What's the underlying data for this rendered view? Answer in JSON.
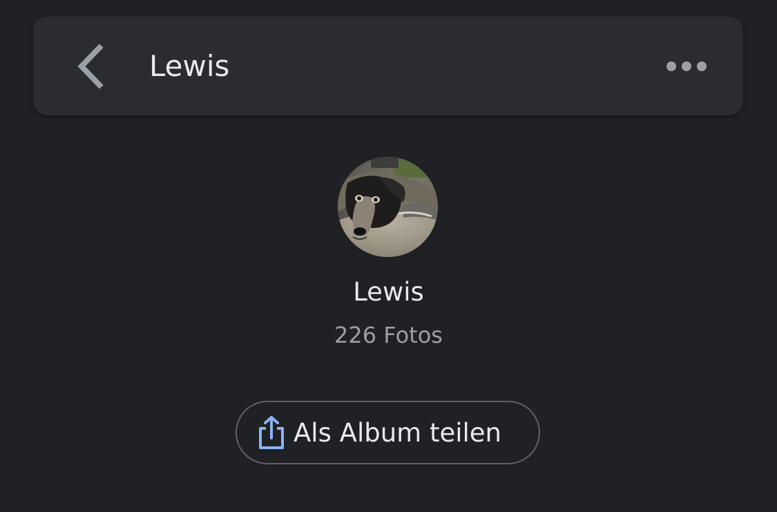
{
  "header": {
    "title": "Lewis",
    "back_icon": "chevron-left-icon",
    "more_icon": "more-horizontal-icon"
  },
  "profile": {
    "name": "Lewis",
    "photo_count": "226 Fotos",
    "avatar_subject": "dog-photo"
  },
  "share": {
    "label": "Als Album teilen",
    "icon": "share-icon",
    "icon_color": "#8ab4f8"
  },
  "colors": {
    "background": "#202124",
    "topbar": "#2b2c30",
    "text_primary": "#e8eaed",
    "text_secondary": "#9aa0a6",
    "accent": "#8ab4f8"
  }
}
